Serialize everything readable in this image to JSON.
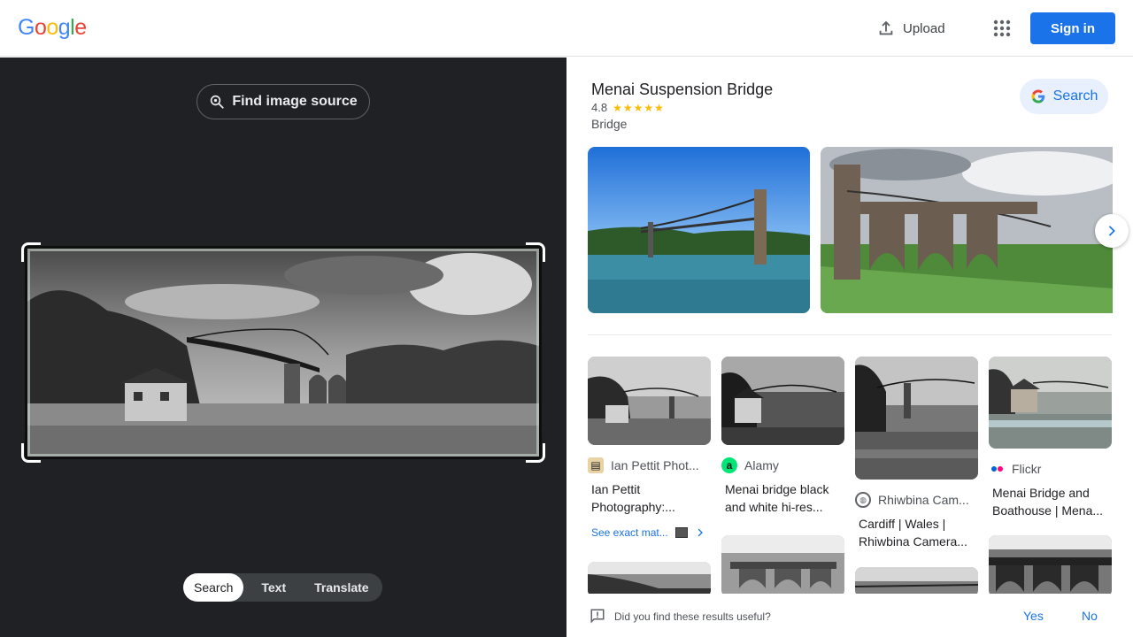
{
  "header": {
    "logo_letters": [
      "G",
      "o",
      "o",
      "g",
      "l",
      "e"
    ],
    "logo_colors": [
      "#4285f4",
      "#ea4335",
      "#fbbc05",
      "#4285f4",
      "#34a853",
      "#ea4335"
    ],
    "upload_label": "Upload",
    "apps_icon": "apps-grid-icon",
    "signin_label": "Sign in"
  },
  "left": {
    "find_source_label": "Find image source",
    "modes": [
      {
        "label": "Search",
        "active": true
      },
      {
        "label": "Text",
        "active": false
      },
      {
        "label": "Translate",
        "active": false
      }
    ]
  },
  "knowledge_panel": {
    "title": "Menai Suspension Bridge",
    "rating": "4.8",
    "stars": "★★★★★",
    "type": "Bridge",
    "search_label": "Search"
  },
  "results": [
    {
      "source": "Ian Pettit Phot...",
      "title_line1": "Ian Pettit",
      "title_line2": "Photography:..."
    },
    {
      "source": "Alamy",
      "title_line1": "Menai bridge black",
      "title_line2": "and white hi-res..."
    },
    {
      "source": "Rhiwbina Cam...",
      "title_line1": "Cardiff | Wales |",
      "title_line2": "Rhiwbina Camera..."
    },
    {
      "source": "Flickr",
      "title_line1": "Menai Bridge and",
      "title_line2": "Boathouse | Mena..."
    }
  ],
  "exact_matches_label": "See exact mat...",
  "feedback": {
    "question": "Did you find these results useful?",
    "yes": "Yes",
    "no": "No"
  },
  "colors": {
    "accent": "#1a73e8",
    "dark_pane": "#202124"
  }
}
